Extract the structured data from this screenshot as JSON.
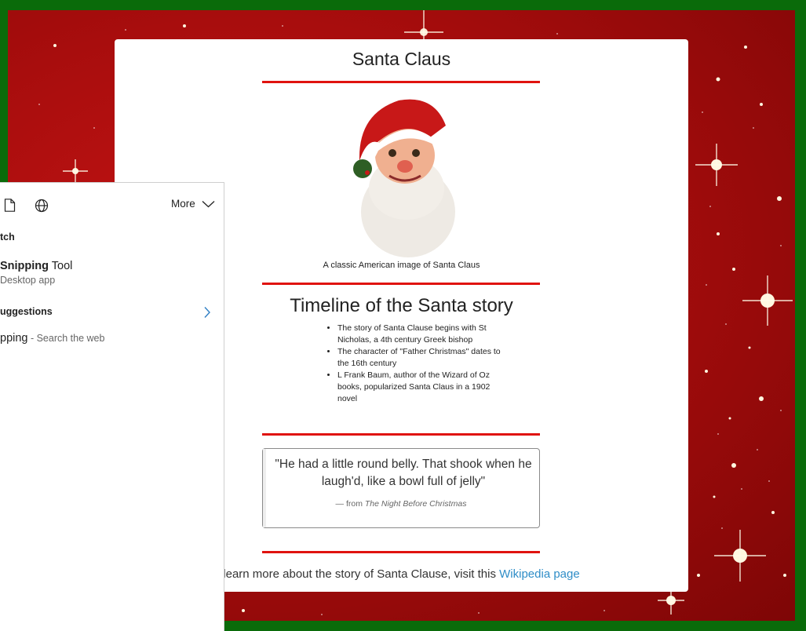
{
  "page": {
    "title": "Santa Claus",
    "image_caption": "A classic American image of Santa Claus",
    "timeline_heading": "Timeline of the Santa story",
    "timeline": [
      "The story of Santa Clause begins with St Nicholas, a 4th century Greek bishop",
      "The character of \"Father Christmas\" dates to the 16th century",
      "L Frank Baum, author of the Wizard of Oz books, popularized Santa Claus in a 1902 novel"
    ],
    "quote": {
      "text": "\"He had a little round belly. That shook when he laugh'd, like a bowl full of jelly\"",
      "cite_prefix": "— from",
      "cite_title": "The Night Before Christmas"
    },
    "learn_more": {
      "text": "learn more about the story of Santa Clause, visit this",
      "link": "Wikipedia page"
    }
  },
  "search_flyout": {
    "more_label": "More",
    "best_match_heading": "tch",
    "app": {
      "name_bold": "Snipping",
      "name_rest": " Tool",
      "type": "Desktop app"
    },
    "suggestions_heading": "uggestions",
    "web_suggestion": {
      "term": "pping",
      "hint": " - Search the web"
    },
    "icons": [
      "document-icon",
      "globe-icon",
      "chevron-down-icon",
      "chevron-right-icon"
    ]
  },
  "colors": {
    "border_green": "#0a6b0a",
    "background_red": "#a80d0d",
    "rule_red": "#e0130f",
    "link_blue": "#2f8dc7"
  }
}
